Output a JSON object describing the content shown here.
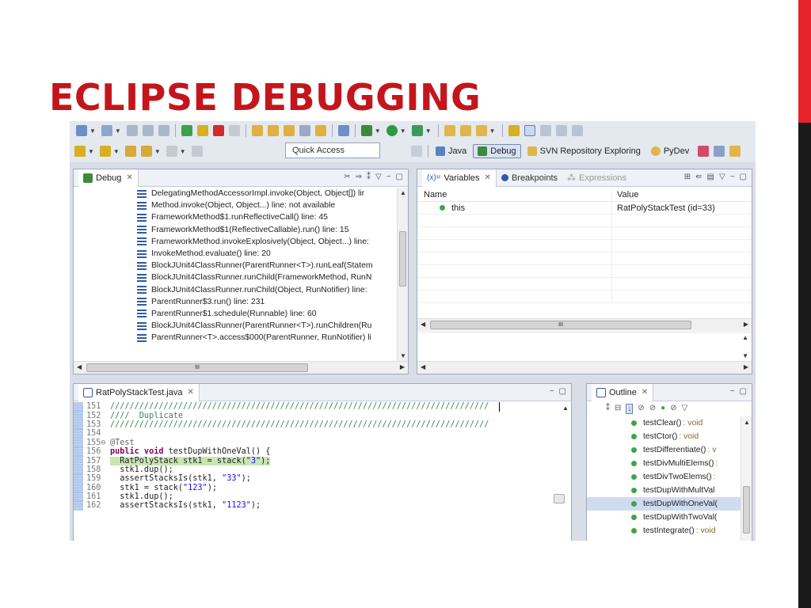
{
  "slide": {
    "title": "ECLIPSE DEBUGGING"
  },
  "toolbar": {
    "quick_access": "Quick Access",
    "perspectives": [
      "Java",
      "Debug",
      "SVN Repository Exploring",
      "PyDev"
    ],
    "active_perspective": "Debug"
  },
  "debug_view": {
    "tab_label": "Debug",
    "frames": [
      "DelegatingMethodAccessorImpl.invoke(Object, Object[]) lir",
      "Method.invoke(Object, Object...) line: not available",
      "FrameworkMethod$1.runReflectiveCall() line: 45",
      "FrameworkMethod$1(ReflectiveCallable).run() line: 15",
      "FrameworkMethod.invokeExplosively(Object, Object...) line:",
      "InvokeMethod.evaluate() line: 20",
      "BlockJUnit4ClassRunner(ParentRunner<T>).runLeaf(Statem",
      "BlockJUnit4ClassRunner.runChild(FrameworkMethod, RunN",
      "BlockJUnit4ClassRunner.runChild(Object, RunNotifier) line:",
      "ParentRunner$3.run() line: 231",
      "ParentRunner$1.schedule(Runnable) line: 60",
      "BlockJUnit4ClassRunner(ParentRunner<T>).runChildren(Ru",
      "ParentRunner<T>.access$000(ParentRunner, RunNotifier) li"
    ],
    "hscroll_label": "III"
  },
  "variables_view": {
    "tabs": [
      "Variables",
      "Breakpoints",
      "Expressions"
    ],
    "columns": [
      "Name",
      "Value"
    ],
    "rows": [
      {
        "name": "this",
        "value": "RatPolyStackTest  (id=33)"
      }
    ],
    "hscroll_label": "III"
  },
  "editor": {
    "tab_label": "RatPolyStackTest.java",
    "lines": [
      {
        "num": "151",
        "parts": [
          {
            "t": "//////////////////////////////////////////////////////////////////////////////",
            "c": "cmt"
          }
        ]
      },
      {
        "num": "152",
        "parts": [
          {
            "t": "////  Duplicate",
            "c": "cmt"
          }
        ]
      },
      {
        "num": "153",
        "parts": [
          {
            "t": "//////////////////////////////////////////////////////////////////////////////",
            "c": "cmt"
          }
        ]
      },
      {
        "num": "154",
        "parts": []
      },
      {
        "num": "155⊖",
        "parts": [
          {
            "t": "@Test",
            "c": "ann"
          }
        ]
      },
      {
        "num": "156",
        "parts": [
          {
            "t": "public void",
            "c": "kw"
          },
          {
            "t": " testDupWithOneVal() {",
            "c": ""
          }
        ]
      },
      {
        "num": "157",
        "hl": true,
        "parts": [
          {
            "t": "  RatPolyStack stk1 = stack(",
            "c": ""
          },
          {
            "t": "\"3\"",
            "c": "str"
          },
          {
            "t": ");",
            "c": ""
          }
        ]
      },
      {
        "num": "158",
        "parts": [
          {
            "t": "  stk1.dup();",
            "c": ""
          }
        ]
      },
      {
        "num": "159",
        "parts": [
          {
            "t": "  assertStacksIs(stk1, ",
            "c": ""
          },
          {
            "t": "\"33\"",
            "c": "str"
          },
          {
            "t": ");",
            "c": ""
          }
        ]
      },
      {
        "num": "160",
        "parts": [
          {
            "t": "  stk1 = stack(",
            "c": ""
          },
          {
            "t": "\"123\"",
            "c": "str"
          },
          {
            "t": ");",
            "c": ""
          }
        ]
      },
      {
        "num": "161",
        "parts": [
          {
            "t": "  stk1.dup();",
            "c": ""
          }
        ]
      },
      {
        "num": "162",
        "parts": [
          {
            "t": "  assertStacksIs(stk1, ",
            "c": ""
          },
          {
            "t": "\"1123\"",
            "c": "str"
          },
          {
            "t": ");",
            "c": ""
          }
        ]
      }
    ]
  },
  "outline_view": {
    "tab_label": "Outline",
    "items": [
      {
        "name": "testClear()",
        "type": " : void"
      },
      {
        "name": "testCtor()",
        "type": " : void"
      },
      {
        "name": "testDifferentiate()",
        "type": " : v"
      },
      {
        "name": "testDivMultiElems()",
        "type": " :"
      },
      {
        "name": "testDivTwoElems()",
        "type": " :"
      },
      {
        "name": "testDupWithMultVal",
        "type": ""
      },
      {
        "name": "testDupWithOneVal(",
        "type": "",
        "selected": true
      },
      {
        "name": "testDupWithTwoVal(",
        "type": ""
      },
      {
        "name": "testIntegrate()",
        "type": " : void"
      }
    ]
  },
  "colors": {
    "title_red": "#c3161c",
    "bar_red": "#e8232a",
    "keyword": "#7f0055",
    "string": "#2a00ff",
    "comment": "#3f7f5f"
  }
}
